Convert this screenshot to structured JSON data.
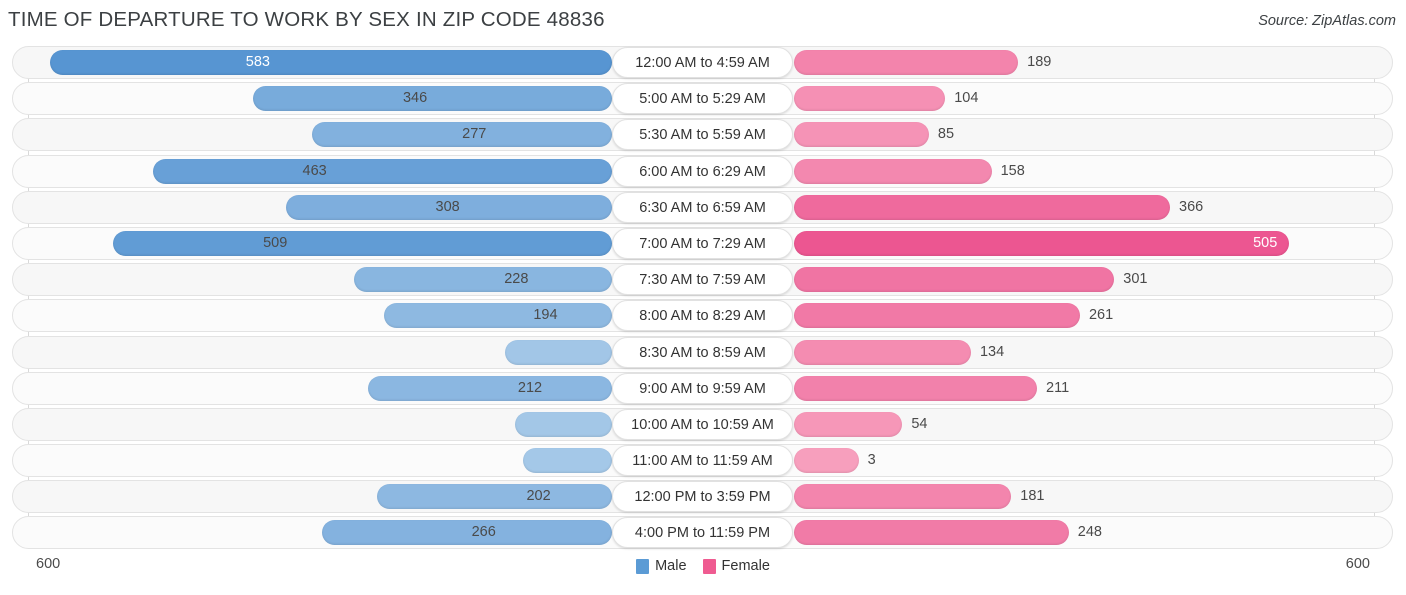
{
  "header": {
    "title": "TIME OF DEPARTURE TO WORK BY SEX IN ZIP CODE 48836",
    "source": "Source: ZipAtlas.com"
  },
  "axis": {
    "left_tick": "600",
    "right_tick": "600",
    "max": 600
  },
  "legend": {
    "male_label": "Male",
    "female_label": "Female",
    "male_color": "#5b9bd5",
    "female_color": "#ef5b91"
  },
  "chart_data": {
    "type": "bar",
    "orientation": "horizontal-diverging",
    "title": "TIME OF DEPARTURE TO WORK BY SEX IN ZIP CODE 48836",
    "xlabel": "",
    "ylabel": "",
    "xlim": [
      600,
      600
    ],
    "grid": true,
    "legend_position": "bottom-center",
    "categories": [
      "12:00 AM to 4:59 AM",
      "5:00 AM to 5:29 AM",
      "5:30 AM to 5:59 AM",
      "6:00 AM to 6:29 AM",
      "6:30 AM to 6:59 AM",
      "7:00 AM to 7:29 AM",
      "7:30 AM to 7:59 AM",
      "8:00 AM to 8:29 AM",
      "8:30 AM to 8:59 AM",
      "9:00 AM to 9:59 AM",
      "10:00 AM to 10:59 AM",
      "11:00 AM to 11:59 AM",
      "12:00 PM to 3:59 PM",
      "4:00 PM to 11:59 PM"
    ],
    "series": [
      {
        "name": "Male",
        "color": "#5b9bd5",
        "values": [
          583,
          346,
          277,
          463,
          308,
          509,
          228,
          194,
          53,
          212,
          41,
          32,
          202,
          266
        ]
      },
      {
        "name": "Female",
        "color": "#ef5b91",
        "values": [
          189,
          104,
          85,
          158,
          366,
          505,
          301,
          261,
          134,
          211,
          54,
          3,
          181,
          248
        ]
      }
    ]
  }
}
